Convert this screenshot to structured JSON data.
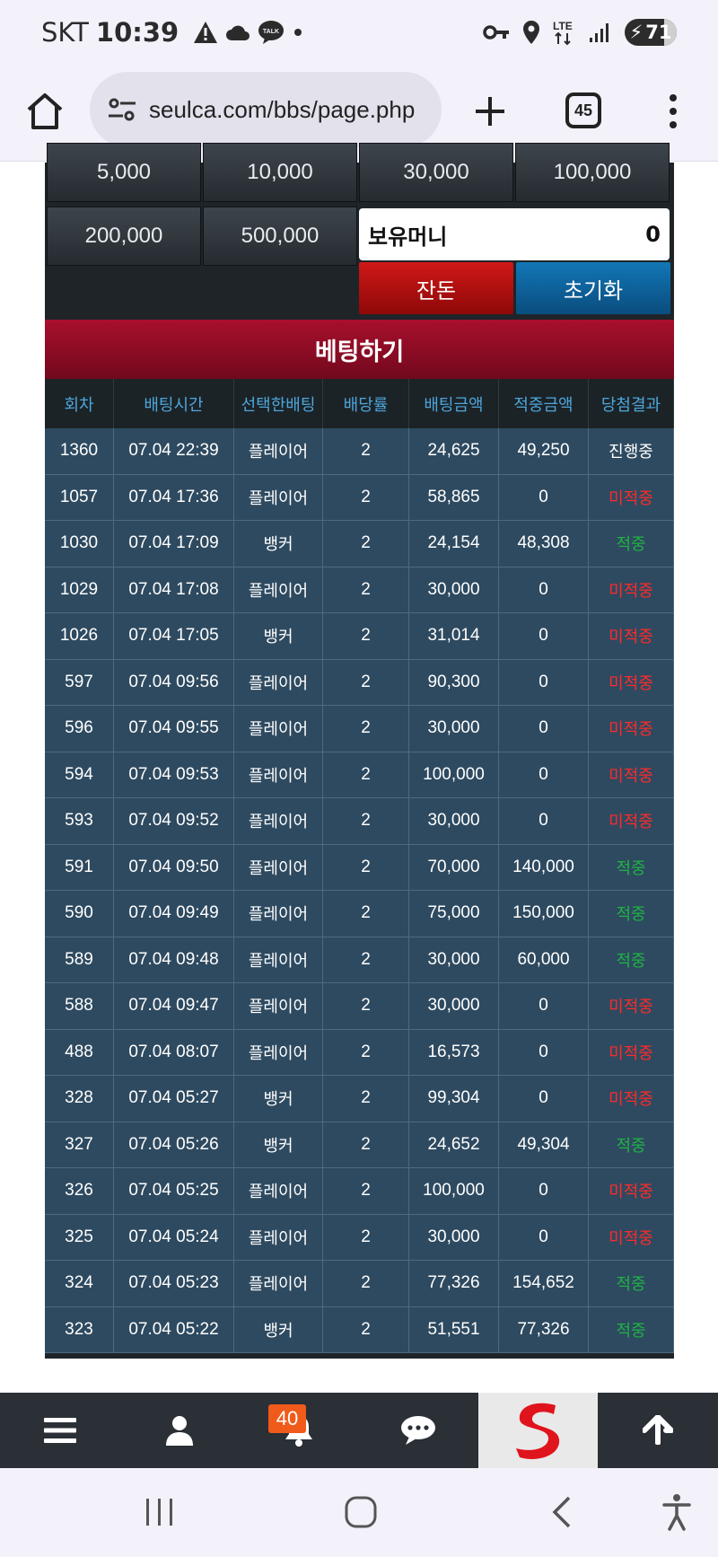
{
  "status": {
    "carrier": "SKT",
    "time": "10:39",
    "battery": "71"
  },
  "browser": {
    "url": "seulca.com/bbs/page.php",
    "tab_count": "45"
  },
  "chips": [
    "5,000",
    "10,000",
    "30,000",
    "100,000",
    "200,000",
    "500,000"
  ],
  "money": {
    "label": "보유머니",
    "value": "0"
  },
  "buttons": {
    "change": "잔돈",
    "reset": "초기화"
  },
  "bet_title": "베팅하기",
  "table": {
    "headers": [
      "회차",
      "배팅시간",
      "선택한배팅",
      "배당률",
      "배팅금액",
      "적중금액",
      "당첨결과"
    ],
    "rows": [
      [
        "1360",
        "07.04 22:39",
        "플레이어",
        "2",
        "24,625",
        "49,250",
        "진행중"
      ],
      [
        "1057",
        "07.04 17:36",
        "플레이어",
        "2",
        "58,865",
        "0",
        "미적중"
      ],
      [
        "1030",
        "07.04 17:09",
        "뱅커",
        "2",
        "24,154",
        "48,308",
        "적중"
      ],
      [
        "1029",
        "07.04 17:08",
        "플레이어",
        "2",
        "30,000",
        "0",
        "미적중"
      ],
      [
        "1026",
        "07.04 17:05",
        "뱅커",
        "2",
        "31,014",
        "0",
        "미적중"
      ],
      [
        "597",
        "07.04 09:56",
        "플레이어",
        "2",
        "90,300",
        "0",
        "미적중"
      ],
      [
        "596",
        "07.04 09:55",
        "플레이어",
        "2",
        "30,000",
        "0",
        "미적중"
      ],
      [
        "594",
        "07.04 09:53",
        "플레이어",
        "2",
        "100,000",
        "0",
        "미적중"
      ],
      [
        "593",
        "07.04 09:52",
        "플레이어",
        "2",
        "30,000",
        "0",
        "미적중"
      ],
      [
        "591",
        "07.04 09:50",
        "플레이어",
        "2",
        "70,000",
        "140,000",
        "적중"
      ],
      [
        "590",
        "07.04 09:49",
        "플레이어",
        "2",
        "75,000",
        "150,000",
        "적중"
      ],
      [
        "589",
        "07.04 09:48",
        "플레이어",
        "2",
        "30,000",
        "60,000",
        "적중"
      ],
      [
        "588",
        "07.04 09:47",
        "플레이어",
        "2",
        "30,000",
        "0",
        "미적중"
      ],
      [
        "488",
        "07.04 08:07",
        "플레이어",
        "2",
        "16,573",
        "0",
        "미적중"
      ],
      [
        "328",
        "07.04 05:27",
        "뱅커",
        "2",
        "99,304",
        "0",
        "미적중"
      ],
      [
        "327",
        "07.04 05:26",
        "뱅커",
        "2",
        "24,652",
        "49,304",
        "적중"
      ],
      [
        "326",
        "07.04 05:25",
        "플레이어",
        "2",
        "100,000",
        "0",
        "미적중"
      ],
      [
        "325",
        "07.04 05:24",
        "플레이어",
        "2",
        "30,000",
        "0",
        "미적중"
      ],
      [
        "324",
        "07.04 05:23",
        "플레이어",
        "2",
        "77,326",
        "154,652",
        "적중"
      ],
      [
        "323",
        "07.04 05:22",
        "뱅커",
        "2",
        "51,551",
        "77,326",
        "적중"
      ]
    ]
  },
  "site_nav": {
    "notification_count": "40",
    "icons": [
      "hamburger-menu-icon",
      "user-icon",
      "bell-icon",
      "chat-icon",
      "site-logo",
      "arrow-up-icon"
    ]
  },
  "colors": {
    "result_miss": "#ff2a2a",
    "result_hit": "#1fb344",
    "header_red": "#a80f2c",
    "reset_blue": "#1276b6"
  }
}
